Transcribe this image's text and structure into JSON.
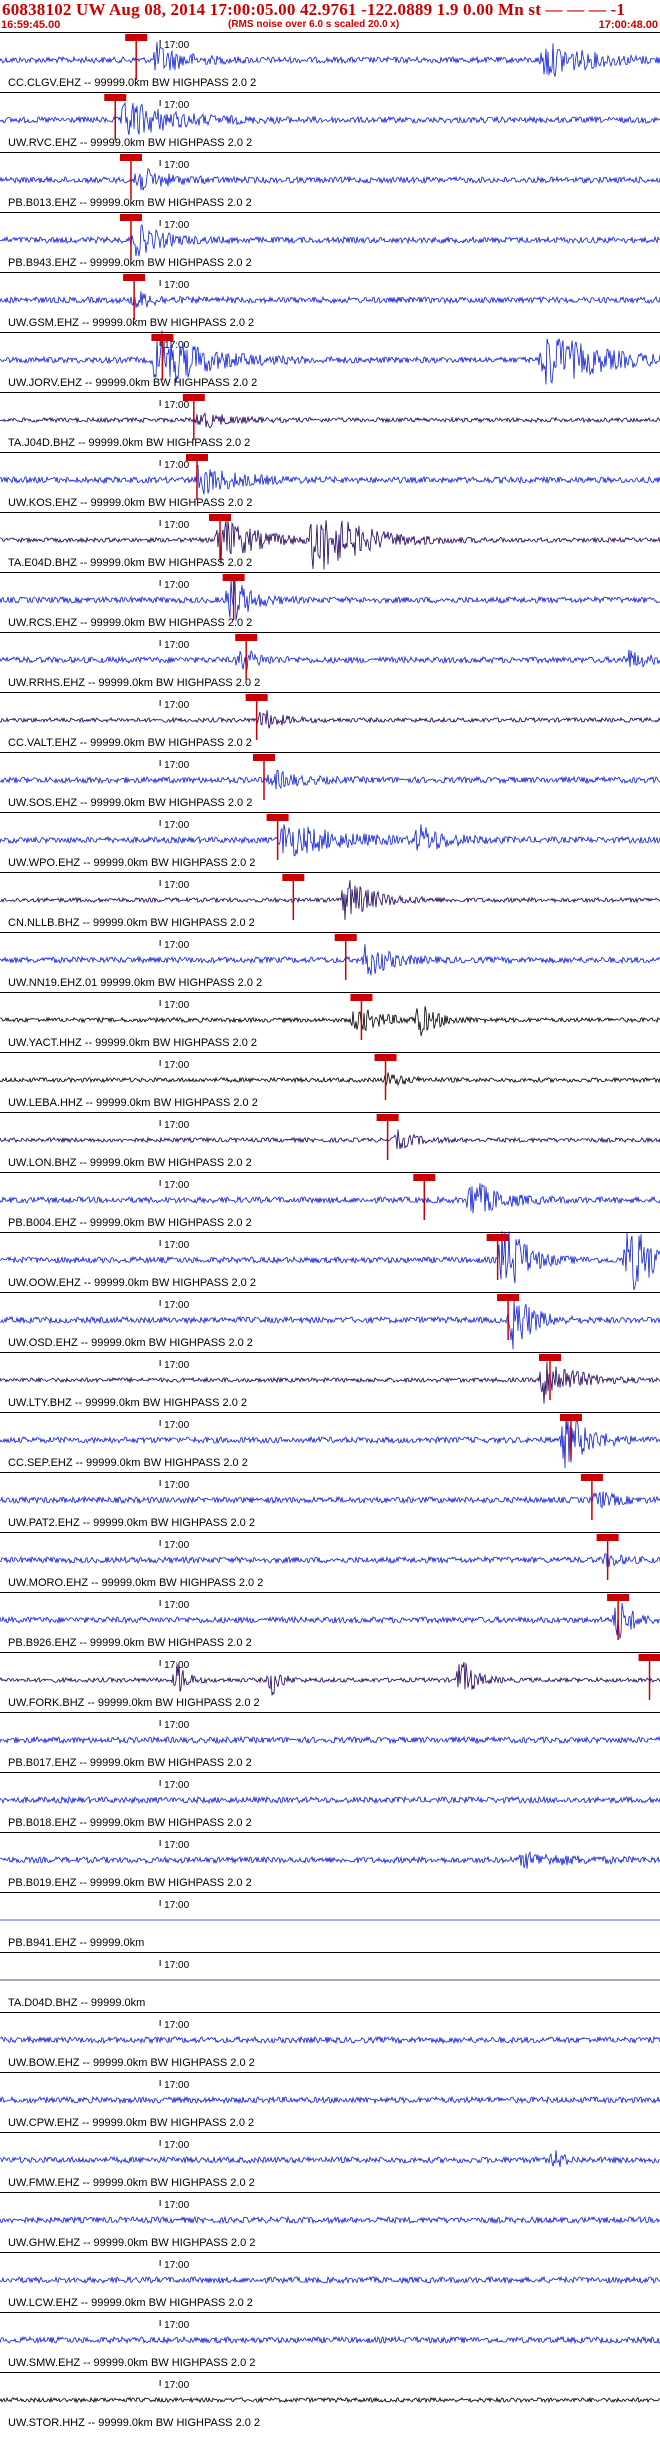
{
  "header": {
    "title": "60838102 UW Aug 08, 2014 17:00:05.00   42.9761 -122.0889  1.9 0.00 Mn st — — — -1",
    "start_time": "16:59:45.00",
    "end_time": "17:00:48.00",
    "note": "(RMS noise over 6.0 s scaled 20.0 x)"
  },
  "colors": {
    "header_text": "#cc0000",
    "pick_marker": "#cc0000",
    "pick_line": "#cc0000",
    "grid_line": "#000000",
    "blue_trace": "#1020d8",
    "navy_trace": "#200060",
    "black_trace": "#000000"
  },
  "chart_data": {
    "type": "seismogram",
    "minute_mark_label": "17:00",
    "time_range": [
      "16:59:45.00",
      "17:00:48.00"
    ],
    "traces": [
      {
        "label": "CC.CLGV.EHZ -- 99999.0km BW  HIGHPASS  2.0  2",
        "color": "blue",
        "pick_time_s": 13.0,
        "bursts": [
          {
            "t": 15,
            "amp": 0.7,
            "dur": 6
          },
          {
            "t": 52,
            "amp": 0.8,
            "dur": 10
          }
        ]
      },
      {
        "label": "UW.RVC.EHZ -- 99999.0km BW  HIGHPASS  2.0  2",
        "color": "blue",
        "pick_time_s": 11.0,
        "bursts": [
          {
            "t": 12,
            "amp": 0.9,
            "dur": 10
          }
        ]
      },
      {
        "label": "PB.B013.EHZ -- 99999.0km BW  HIGHPASS  2.0  2",
        "color": "blue",
        "pick_time_s": 12.5,
        "bursts": [
          {
            "t": 13,
            "amp": 0.6,
            "dur": 6
          }
        ]
      },
      {
        "label": "PB.B943.EHZ -- 99999.0km BW  HIGHPASS  2.0  2",
        "color": "blue",
        "pick_time_s": 12.5,
        "bursts": [
          {
            "t": 13,
            "amp": 0.7,
            "dur": 6
          }
        ]
      },
      {
        "label": "UW.GSM.EHZ -- 99999.0km BW  HIGHPASS  2.0  2",
        "color": "blue",
        "pick_time_s": 12.8,
        "bursts": [
          {
            "t": 13,
            "amp": 0.4,
            "dur": 4
          }
        ]
      },
      {
        "label": "UW.JORV.EHZ -- 99999.0km BW  HIGHPASS  2.0  2",
        "color": "blue",
        "pick_time_s": 15.5,
        "bursts": [
          {
            "t": 15,
            "amp": 1.4,
            "dur": 10
          },
          {
            "t": 52,
            "amp": 1.3,
            "dur": 12
          }
        ]
      },
      {
        "label": "TA.J04D.BHZ -- 99999.0km BW  HIGHPASS  2.0  2",
        "color": "navy",
        "pick_time_s": 18.5,
        "bursts": [
          {
            "t": 19,
            "amp": 0.4,
            "dur": 6
          }
        ]
      },
      {
        "label": "UW.KOS.EHZ -- 99999.0km BW  HIGHPASS  2.0  2",
        "color": "blue",
        "pick_time_s": 18.8,
        "bursts": [
          {
            "t": 19,
            "amp": 0.7,
            "dur": 8
          }
        ]
      },
      {
        "label": "TA.E04D.BHZ -- 99999.0km BW  HIGHPASS  2.0  2",
        "color": "navy",
        "pick_time_s": 21.0,
        "bursts": [
          {
            "t": 21,
            "amp": 1.1,
            "dur": 8
          },
          {
            "t": 30,
            "amp": 1.6,
            "dur": 10
          }
        ]
      },
      {
        "label": "UW.RCS.EHZ -- 99999.0km BW  HIGHPASS  2.0  2",
        "color": "blue",
        "pick_time_s": 22.3,
        "bursts": [
          {
            "t": 22,
            "amp": 1.2,
            "dur": 4
          }
        ]
      },
      {
        "label": "UW.RRHS.EHZ -- 99999.0km BW  HIGHPASS  2.0  2",
        "color": "blue",
        "pick_time_s": 23.5,
        "bursts": [
          {
            "t": 23,
            "amp": 0.5,
            "dur": 4
          },
          {
            "t": 60,
            "amp": 0.4,
            "dur": 4
          }
        ]
      },
      {
        "label": "CC.VALT.EHZ -- 99999.0km BW  HIGHPASS  2.0  2",
        "color": "navy",
        "pick_time_s": 24.5,
        "bursts": [
          {
            "t": 25,
            "amp": 0.5,
            "dur": 4
          }
        ]
      },
      {
        "label": "UW.SOS.EHZ -- 99999.0km BW  HIGHPASS  2.0  2",
        "color": "blue",
        "pick_time_s": 25.2,
        "bursts": [
          {
            "t": 26,
            "amp": 0.4,
            "dur": 6
          }
        ]
      },
      {
        "label": "UW.WPO.EHZ -- 99999.0km BW  HIGHPASS  2.0  2",
        "color": "blue",
        "pick_time_s": 26.5,
        "bursts": [
          {
            "t": 27,
            "amp": 0.8,
            "dur": 12
          },
          {
            "t": 40,
            "amp": 0.6,
            "dur": 6
          }
        ]
      },
      {
        "label": "CN.NLLB.BHZ -- 99999.0km BW  HIGHPASS  2.0  2",
        "color": "navy",
        "pick_time_s": 28.0,
        "bursts": [
          {
            "t": 33,
            "amp": 1.0,
            "dur": 6
          }
        ]
      },
      {
        "label": "UW.NN19.EHZ.01 99999.0km BW  HIGHPASS  2.0  2",
        "color": "blue",
        "pick_time_s": 33.0,
        "bursts": [
          {
            "t": 35,
            "amp": 0.8,
            "dur": 5
          }
        ]
      },
      {
        "label": "UW.YACT.HHZ -- 99999.0km BW  HIGHPASS  2.0  2",
        "color": "black",
        "pick_time_s": 34.5,
        "bursts": [
          {
            "t": 34,
            "amp": 0.6,
            "dur": 6
          },
          {
            "t": 40,
            "amp": 0.7,
            "dur": 4
          }
        ]
      },
      {
        "label": "UW.LEBA.HHZ -- 99999.0km BW  HIGHPASS  2.0  2",
        "color": "black",
        "pick_time_s": 36.8,
        "bursts": [
          {
            "t": 37,
            "amp": 0.3,
            "dur": 4
          }
        ]
      },
      {
        "label": "UW.LON.BHZ -- 99999.0km BW  HIGHPASS  2.0  2",
        "color": "navy",
        "pick_time_s": 37.0,
        "bursts": [
          {
            "t": 38,
            "amp": 0.4,
            "dur": 4
          }
        ]
      },
      {
        "label": "PB.B004.EHZ -- 99999.0km BW  HIGHPASS  2.0  2",
        "color": "blue",
        "pick_time_s": 40.5,
        "bursts": [
          {
            "t": 45,
            "amp": 0.9,
            "dur": 6
          }
        ]
      },
      {
        "label": "UW.OOW.EHZ -- 99999.0km BW  HIGHPASS  2.0  2",
        "color": "blue",
        "pick_time_s": 47.5,
        "bursts": [
          {
            "t": 48,
            "amp": 2.6,
            "dur": 4
          },
          {
            "t": 60,
            "amp": 2.6,
            "dur": 4
          }
        ]
      },
      {
        "label": "UW.OSD.EHZ -- 99999.0km BW  HIGHPASS  2.0  2",
        "color": "blue",
        "pick_time_s": 48.5,
        "bursts": [
          {
            "t": 49,
            "amp": 1.5,
            "dur": 4
          }
        ]
      },
      {
        "label": "UW.LTY.BHZ -- 99999.0km BW  HIGHPASS  2.0  2",
        "color": "navy",
        "pick_time_s": 52.5,
        "bursts": [
          {
            "t": 52,
            "amp": 1.2,
            "dur": 6
          }
        ]
      },
      {
        "label": "CC.SEP.EHZ -- 99999.0km BW  HIGHPASS  2.0  2",
        "color": "blue",
        "pick_time_s": 54.5,
        "bursts": [
          {
            "t": 54,
            "amp": 1.3,
            "dur": 5
          }
        ]
      },
      {
        "label": "UW.PAT2.EHZ -- 99999.0km BW  HIGHPASS  2.0  2",
        "color": "blue",
        "pick_time_s": 56.5,
        "bursts": [
          {
            "t": 57,
            "amp": 0.4,
            "dur": 4
          }
        ]
      },
      {
        "label": "UW.MORO.EHZ -- 99999.0km BW  HIGHPASS  2.0  2",
        "color": "blue",
        "pick_time_s": 58.0,
        "bursts": [
          {
            "t": 58,
            "amp": 0.3,
            "dur": 3
          }
        ]
      },
      {
        "label": "PB.B926.EHZ -- 99999.0km BW  HIGHPASS  2.0  2",
        "color": "blue",
        "pick_time_s": 59.0,
        "bursts": [
          {
            "t": 59,
            "amp": 1.0,
            "dur": 3
          }
        ]
      },
      {
        "label": "UW.FORK.BHZ -- 99999.0km BW  HIGHPASS  2.0  2",
        "color": "navy",
        "pick_time_s": 62.0,
        "bursts": [
          {
            "t": 17,
            "amp": 0.8,
            "dur": 2
          },
          {
            "t": 26,
            "amp": 0.7,
            "dur": 2
          },
          {
            "t": 44,
            "amp": 1.0,
            "dur": 3
          }
        ]
      },
      {
        "label": "PB.B017.EHZ -- 99999.0km BW  HIGHPASS  2.0  2",
        "color": "blue",
        "pick_time_s": null,
        "bursts": []
      },
      {
        "label": "PB.B018.EHZ -- 99999.0km BW  HIGHPASS  2.0  2",
        "color": "blue",
        "pick_time_s": null,
        "bursts": []
      },
      {
        "label": "PB.B019.EHZ -- 99999.0km BW  HIGHPASS  2.0  2",
        "color": "blue",
        "pick_time_s": null,
        "bursts": [
          {
            "t": 50,
            "amp": 0.3,
            "dur": 10
          }
        ]
      },
      {
        "label": "PB.B941.EHZ -- 99999.0km",
        "color": "blue",
        "pick_time_s": null,
        "bursts": [],
        "flat": true
      },
      {
        "label": "TA.D04D.BHZ -- 99999.0km",
        "color": "navy",
        "pick_time_s": null,
        "bursts": [],
        "flat": true
      },
      {
        "label": "UW.BOW.EHZ -- 99999.0km BW  HIGHPASS  2.0  2",
        "color": "blue",
        "pick_time_s": null,
        "bursts": []
      },
      {
        "label": "UW.CPW.EHZ -- 99999.0km BW  HIGHPASS  2.0  2",
        "color": "blue",
        "pick_time_s": null,
        "bursts": []
      },
      {
        "label": "UW.FMW.EHZ -- 99999.0km BW  HIGHPASS  2.0  2",
        "color": "blue",
        "pick_time_s": null,
        "bursts": [
          {
            "t": 53,
            "amp": 0.4,
            "dur": 2
          }
        ]
      },
      {
        "label": "UW.GHW.EHZ -- 99999.0km BW  HIGHPASS  2.0  2",
        "color": "blue",
        "pick_time_s": null,
        "bursts": []
      },
      {
        "label": "UW.LCW.EHZ -- 99999.0km BW  HIGHPASS  2.0  2",
        "color": "blue",
        "pick_time_s": null,
        "bursts": []
      },
      {
        "label": "UW.SMW.EHZ -- 99999.0km BW  HIGHPASS  2.0  2",
        "color": "blue",
        "pick_time_s": null,
        "bursts": []
      },
      {
        "label": "UW.STOR.HHZ -- 99999.0km BW  HIGHPASS  2.0  2",
        "color": "black",
        "pick_time_s": null,
        "bursts": []
      }
    ]
  }
}
